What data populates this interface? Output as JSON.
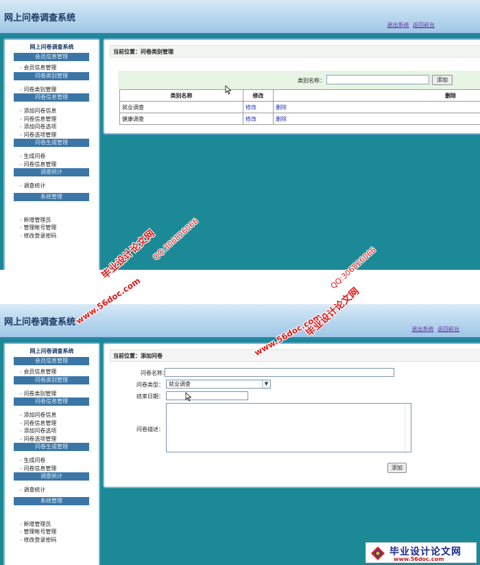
{
  "app": {
    "title": "网上问卷调查系统",
    "logout_link": "退出系统",
    "back_link": "返回前台"
  },
  "sidebar": {
    "title": "网上问卷调查系统",
    "groups": [
      {
        "header": "会员信息管理",
        "items": [
          "会员信息管理"
        ]
      },
      {
        "header": "问卷类别管理",
        "items": [
          "问卷类别管理"
        ]
      },
      {
        "header": "问卷信息管理",
        "items": [
          "添加问卷信息",
          "问卷信息管理",
          "添加问卷选项",
          "问卷选项管理"
        ]
      },
      {
        "header": "问卷生成管理",
        "items": [
          "生成问卷",
          "问卷信息管理"
        ]
      },
      {
        "header": "调查统计",
        "items": [
          "调查统计"
        ]
      },
      {
        "header": "系统管理",
        "items": [
          "新增管理员",
          "管理帐号管理",
          "修改登录密码"
        ]
      }
    ]
  },
  "category_page": {
    "breadcrumb": "当前位置：问卷类别管理",
    "search_label": "类别名称：",
    "search_value": "",
    "add_button": "添加",
    "columns": [
      "类别名称",
      "修改",
      "删除"
    ],
    "rows": [
      {
        "name": "就业调查",
        "edit": "修改",
        "delete": "删除"
      },
      {
        "name": "健康调查",
        "edit": "修改",
        "delete": "删除"
      }
    ]
  },
  "add_page": {
    "breadcrumb": "当前位置：添加问卷",
    "name_label": "问卷名称：",
    "name_value": "",
    "type_label": "问卷类型：",
    "type_value": "就业调查",
    "end_date_label": "结束日期：",
    "end_date_value": "",
    "desc_label": "问卷描述：",
    "desc_value": "",
    "add_button": "添加"
  },
  "watermarks": {
    "site_name": "毕业设计论文网",
    "url": "www.56doc.com",
    "qq": "QQ:306826066",
    "logo_text": "毕业设计论文网",
    "logo_url": "www.56doc.com"
  },
  "colors": {
    "header_bg": "#bcd9ef",
    "page_bg": "#1c8a96",
    "menu_header": "#3b76a6",
    "watermark": "#e01a1a"
  }
}
